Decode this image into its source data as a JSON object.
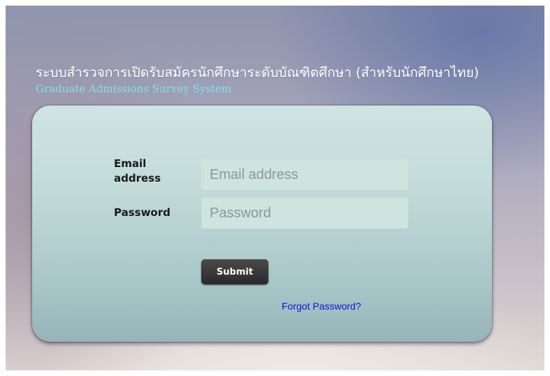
{
  "header": {
    "title_thai": "ระบบสำรวจการเปิดรับสมัครนักศึกษาระดับบัณฑิตศึกษา (สำหรับนักศึกษาไทย)",
    "title_english": "Graduate Admissions Survey System"
  },
  "login_form": {
    "email_label": "Email address",
    "email_placeholder": "Email address",
    "email_value": "",
    "password_label": "Password",
    "password_placeholder": "Password",
    "password_value": "",
    "submit_label": "Submit",
    "forgot_password_link": "Forgot Password?"
  },
  "colors": {
    "title_thai": "#ffffff",
    "title_english": "#7fe0ee",
    "card_background": "#c2dbd9",
    "input_background": "#cde4df",
    "submit_background": "#2f2f2f",
    "link": "#0a14d8"
  }
}
